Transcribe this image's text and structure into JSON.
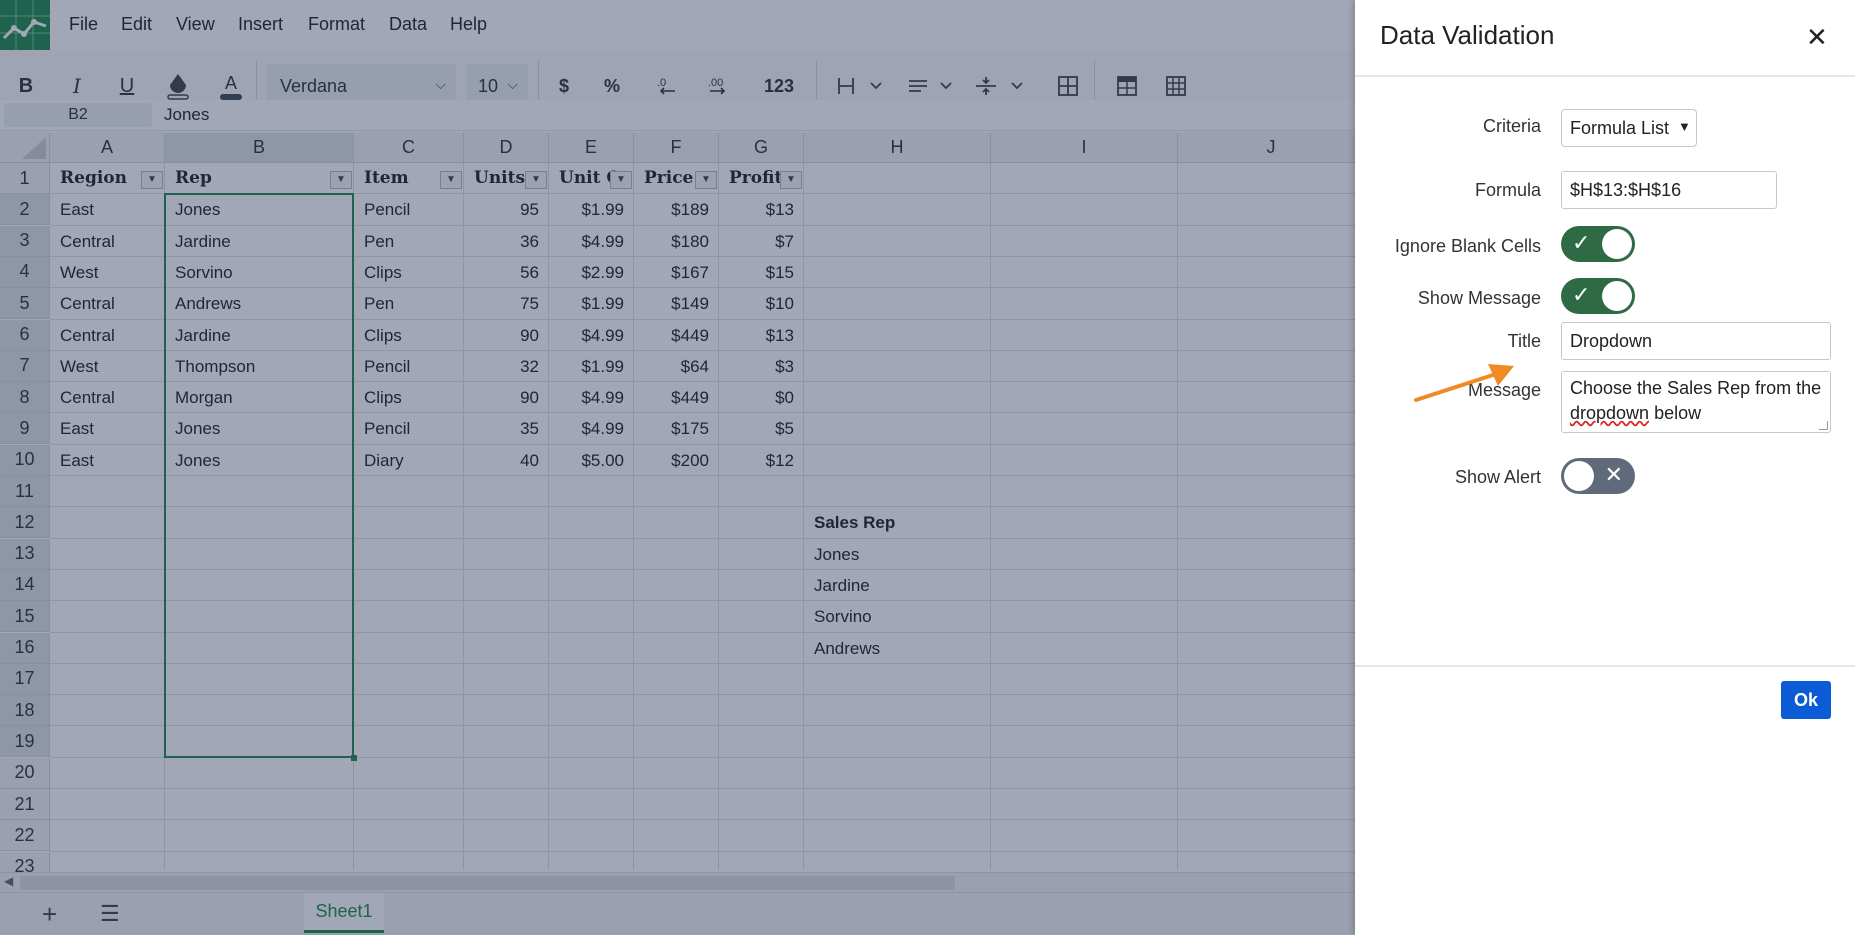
{
  "menu": [
    "File",
    "Edit",
    "View",
    "Insert",
    "Format",
    "Data",
    "Help"
  ],
  "toolbar": {
    "font": "Verdana",
    "size": "10",
    "currency_label": "$",
    "percent_label": "%",
    "number_format_label": "123"
  },
  "formula_bar": {
    "cell_ref": "B2",
    "value": "Jones"
  },
  "grid": {
    "columns": [
      "A",
      "B",
      "C",
      "D",
      "E",
      "F",
      "G",
      "H",
      "I",
      "J"
    ],
    "rows": [
      "1",
      "2",
      "3",
      "4",
      "5",
      "6",
      "7",
      "8",
      "9",
      "10",
      "11",
      "12",
      "13",
      "14",
      "15",
      "16",
      "17",
      "18",
      "19",
      "20",
      "21",
      "22",
      "23"
    ],
    "headers": [
      "Region",
      "Rep",
      "Item",
      "Units",
      "Unit C",
      "Price",
      "Profits"
    ],
    "data": [
      [
        "East",
        "Jones",
        "Pencil",
        "95",
        "$1.99",
        "$189",
        "$13"
      ],
      [
        "Central",
        "Jardine",
        "Pen",
        "36",
        "$4.99",
        "$180",
        "$7"
      ],
      [
        "West",
        "Sorvino",
        "Clips",
        "56",
        "$2.99",
        "$167",
        "$15"
      ],
      [
        "Central",
        "Andrews",
        "Pen",
        "75",
        "$1.99",
        "$149",
        "$10"
      ],
      [
        "Central",
        "Jardine",
        "Clips",
        "90",
        "$4.99",
        "$449",
        "$13"
      ],
      [
        "West",
        "Thompson",
        "Pencil",
        "32",
        "$1.99",
        "$64",
        "$3"
      ],
      [
        "Central",
        "Morgan",
        "Clips",
        "90",
        "$4.99",
        "$449",
        "$0"
      ],
      [
        "East",
        "Jones",
        "Pencil",
        "35",
        "$4.99",
        "$175",
        "$5"
      ],
      [
        "East",
        "Jones",
        "Diary",
        "40",
        "$5.00",
        "$200",
        "$12"
      ]
    ],
    "sales_rep_header": "Sales Rep",
    "sales_reps": [
      "Jones",
      "Jardine",
      "Sorvino",
      "Andrews"
    ]
  },
  "sheet_tab": "Sheet1",
  "dialog": {
    "title": "Data Validation",
    "criteria_label": "Criteria",
    "criteria_value": "Formula List",
    "formula_label": "Formula",
    "formula_value": "$H$13:$H$16",
    "ignore_blank_label": "Ignore Blank Cells",
    "ignore_blank_on": true,
    "show_message_label": "Show Message",
    "show_message_on": true,
    "title_label": "Title",
    "title_value": "Dropdown",
    "message_label": "Message",
    "message_value_pre": "Choose the Sales Rep from the ",
    "message_value_spell": "dropdown",
    "message_value_post": " below",
    "show_alert_label": "Show Alert",
    "show_alert_on": false,
    "ok_label": "Ok"
  },
  "colors": {
    "accent_green": "#1f8a4c",
    "toggle_on": "#2e6b44",
    "toggle_off": "#5f6b7a",
    "ok_blue": "#0c5bd6",
    "annotation_arrow": "#f08a24"
  }
}
